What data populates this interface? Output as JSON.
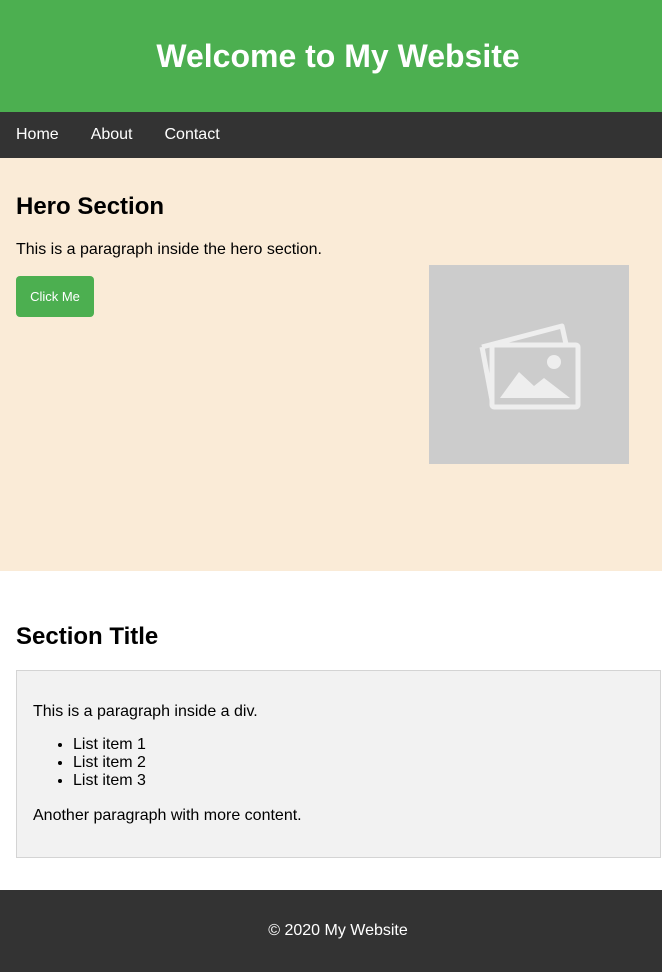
{
  "header": {
    "title": "Welcome to My Website"
  },
  "nav": {
    "items": [
      "Home",
      "About",
      "Contact"
    ]
  },
  "hero": {
    "title": "Hero Section",
    "text": "This is a paragraph inside the hero section.",
    "button_label": "Click Me",
    "image_icon": "image-placeholder-icon"
  },
  "section": {
    "title": "Section Title",
    "paragraph1": "This is a paragraph inside a div.",
    "list_items": [
      "List item 1",
      "List item 2",
      "List item 3"
    ],
    "paragraph2": "Another paragraph with more content."
  },
  "footer": {
    "text": "© 2020 My Website"
  },
  "colors": {
    "header_bg": "#4caf50",
    "nav_bg": "#333333",
    "hero_bg": "#faebd7",
    "button_bg": "#4caf50",
    "box_bg": "#f2f2f2",
    "footer_bg": "#333333"
  }
}
